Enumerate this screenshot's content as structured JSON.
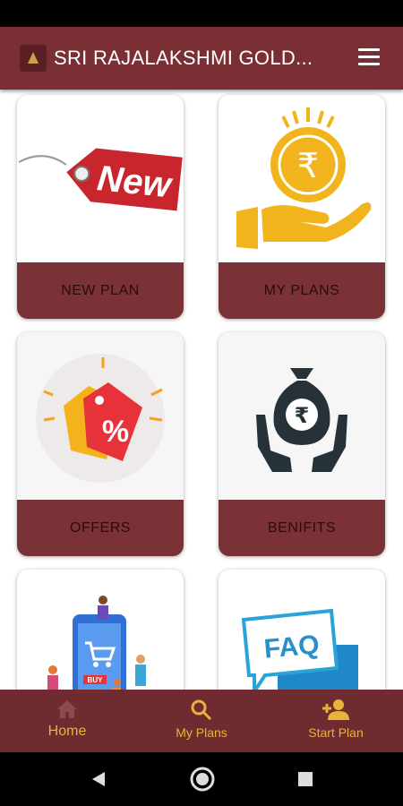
{
  "app": {
    "title": "SRI RAJALAKSHMI GOLD..."
  },
  "tiles": [
    {
      "label": "NEW PLAN",
      "image_text": "New",
      "icon": "new-tag-icon"
    },
    {
      "label": "MY PLANS",
      "image_text": "₹",
      "icon": "coin-hand-icon"
    },
    {
      "label": "OFFERS",
      "image_text": "%",
      "icon": "offer-tag-icon"
    },
    {
      "label": "BENIFITS",
      "image_text": "₹",
      "icon": "money-bag-hands-icon"
    },
    {
      "label": "",
      "image_text": "BUY",
      "icon": "shopping-phone-icon"
    },
    {
      "label": "",
      "image_text": "FAQ",
      "icon": "faq-speech-icon"
    }
  ],
  "bottom_nav": [
    {
      "label": "Home",
      "icon": "home-icon"
    },
    {
      "label": "My Plans",
      "icon": "search-icon"
    },
    {
      "label": "Start Plan",
      "icon": "add-person-icon"
    }
  ],
  "colors": {
    "app_bar": "#7a2f34",
    "tile_label_bg": "#7a3236",
    "accent": "#e8b33a"
  }
}
